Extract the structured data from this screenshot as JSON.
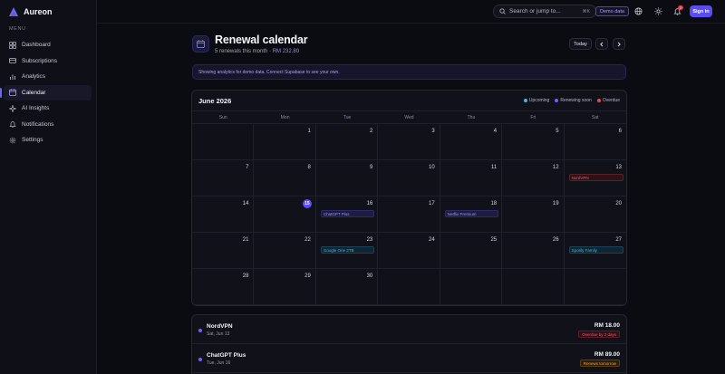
{
  "app": {
    "name": "Aureon",
    "accent": "#5b4cf0"
  },
  "sidebar": {
    "menu_label": "MENU",
    "items": [
      {
        "label": "Dashboard",
        "icon": "dashboard-icon"
      },
      {
        "label": "Subscriptions",
        "icon": "subscriptions-icon"
      },
      {
        "label": "Analytics",
        "icon": "analytics-icon"
      },
      {
        "label": "Calendar",
        "icon": "calendar-icon",
        "active": true
      },
      {
        "label": "AI Insights",
        "icon": "sparkle-icon"
      },
      {
        "label": "Notifications",
        "icon": "bell-icon"
      },
      {
        "label": "Settings",
        "icon": "gear-icon"
      }
    ]
  },
  "topbar": {
    "search_placeholder": "Search or jump to...",
    "search_shortcut": "⌘K",
    "demo_badge": "Demo data",
    "notification_count": "3",
    "signin_label": "Sign in"
  },
  "header": {
    "title": "Renewal calendar",
    "subtitle_prefix": "5 renewals this month · ",
    "subtitle_amount": "RM 232.80",
    "today_label": "Today"
  },
  "notice": "Showing analytics for demo data. Connect Supabase to see your own.",
  "calendar": {
    "month_label": "June 2026",
    "legend": [
      {
        "label": "Upcoming",
        "color": "#3fb6e8"
      },
      {
        "label": "Renewing soon",
        "color": "#6d63ff"
      },
      {
        "label": "Overdue",
        "color": "#ef4458"
      }
    ],
    "weekdays": [
      "Sun",
      "Mon",
      "Tue",
      "Wed",
      "Thu",
      "Fri",
      "Sat"
    ],
    "today": 15,
    "weeks": [
      [
        null,
        1,
        2,
        3,
        4,
        5,
        6
      ],
      [
        7,
        8,
        9,
        10,
        11,
        12,
        13
      ],
      [
        14,
        15,
        16,
        17,
        18,
        19,
        20
      ],
      [
        21,
        22,
        23,
        24,
        25,
        26,
        27
      ],
      [
        28,
        29,
        30,
        null,
        null,
        null,
        null
      ]
    ],
    "events": [
      {
        "day": 13,
        "label": "NordVPN",
        "status": "overdue"
      },
      {
        "day": 16,
        "label": "ChatGPT Plus",
        "status": "soon"
      },
      {
        "day": 18,
        "label": "Netflix Premium",
        "status": "soon"
      },
      {
        "day": 23,
        "label": "Google One 2TB",
        "status": "upcoming"
      },
      {
        "day": 27,
        "label": "Spotify Family",
        "status": "upcoming"
      }
    ]
  },
  "renewals": [
    {
      "name": "NordVPN",
      "date": "Sat, Jun 13",
      "amount": "RM 18.00",
      "status_label": "Overdue by 2 days",
      "status": "overdue",
      "dot": "#6d63ff"
    },
    {
      "name": "ChatGPT Plus",
      "date": "Tue, Jun 16",
      "amount": "RM 89.00",
      "status_label": "Renews tomorrow",
      "status": "tomorrow",
      "dot": "#6d63ff"
    }
  ]
}
